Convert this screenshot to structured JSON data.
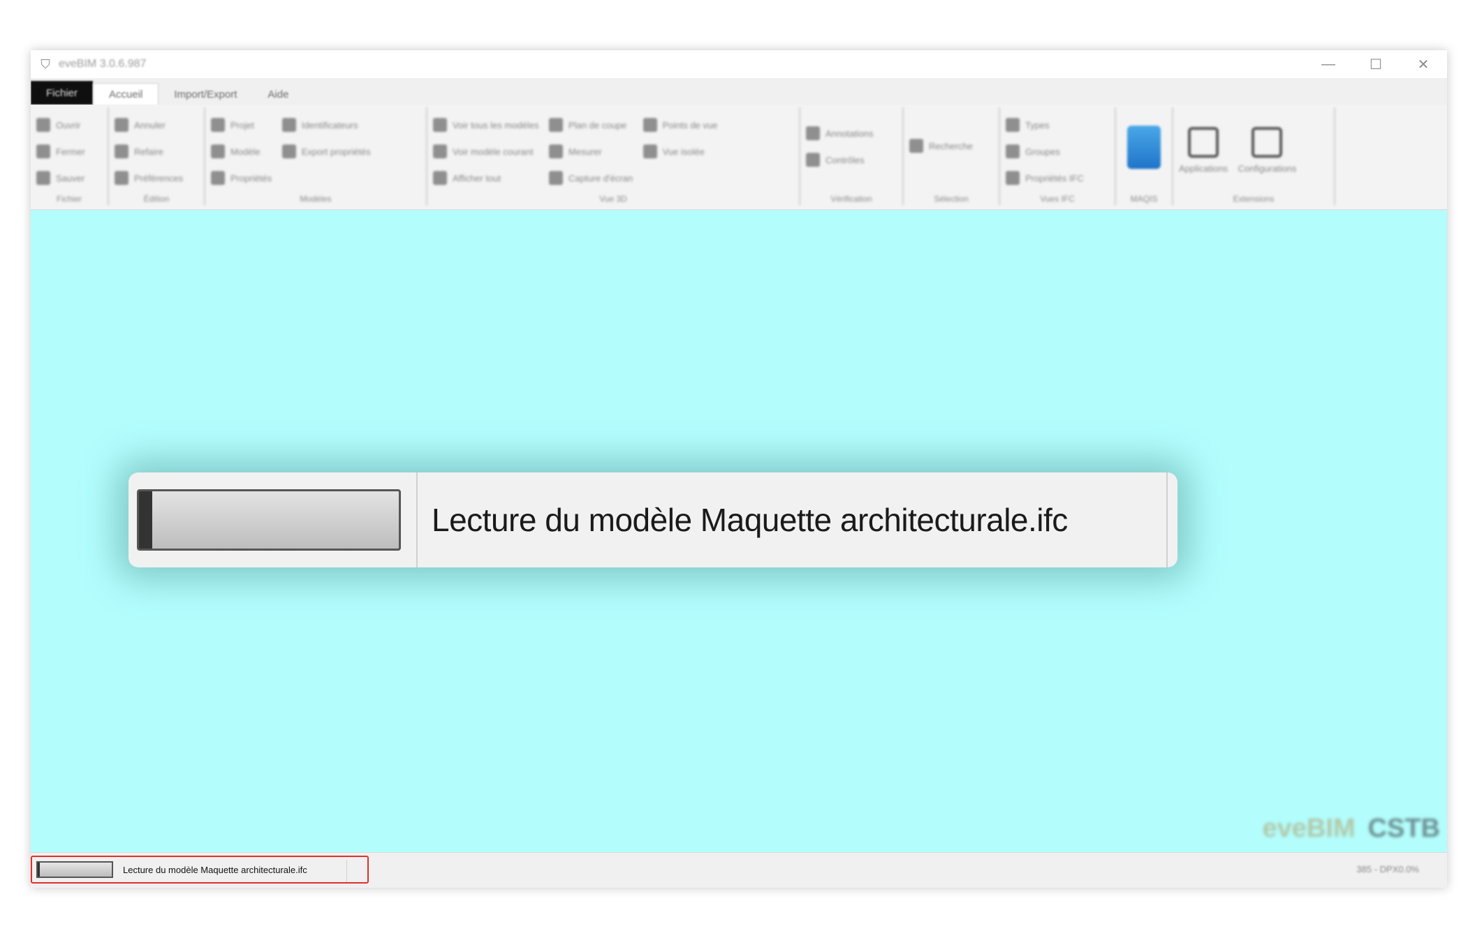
{
  "window": {
    "title": "eveBIM 3.0.6.987",
    "minimize_glyph": "—",
    "maximize_glyph": "☐",
    "close_glyph": "✕"
  },
  "tabs": [
    {
      "label": "Fichier"
    },
    {
      "label": "Accueil"
    },
    {
      "label": "Import/Export"
    },
    {
      "label": "Aide"
    }
  ],
  "ribbon": {
    "groups": [
      {
        "label": "Fichier",
        "items": [
          "Ouvrir",
          "Fermer",
          "Sauver"
        ]
      },
      {
        "label": "Édition",
        "items": [
          "Annuler",
          "Refaire",
          "Préférences"
        ]
      },
      {
        "label": "Modèles",
        "items": [
          "Projet",
          "Modèle",
          "Propriétés",
          "Identificateurs",
          "Export propriétés"
        ]
      },
      {
        "label": "Vue 3D",
        "items": [
          "Voir tous les modèles",
          "Voir modèle courant",
          "Afficher tout",
          "Plan de coupe",
          "Mesurer",
          "Capture d'écran",
          "Points de vue",
          "Vue isolée"
        ]
      },
      {
        "label": "Vérification",
        "items": [
          "Annotations",
          "Contrôles"
        ]
      },
      {
        "label": "Sélection",
        "items": [
          "Recherche"
        ]
      },
      {
        "label": "Vues IFC",
        "items": [
          "Types",
          "Groupes",
          "Propriétés IFC"
        ]
      },
      {
        "label": "MAQIS",
        "items": []
      },
      {
        "label": "Extensions",
        "items": [
          "Applications",
          "Configurations"
        ]
      }
    ]
  },
  "loading_dialog": {
    "message": "Lecture du modèle Maquette architecturale.ifc",
    "progress": 0.05
  },
  "watermark": {
    "brand": "eveBIM",
    "org": "CSTB"
  },
  "statusbar": {
    "message": "Lecture du modèle Maquette architecturale.ifc",
    "progress": 0.03,
    "right_text": "385 - DPX0.0%"
  },
  "colors": {
    "viewport_bg": "#b3fdfd",
    "highlight": "#e0302a"
  }
}
